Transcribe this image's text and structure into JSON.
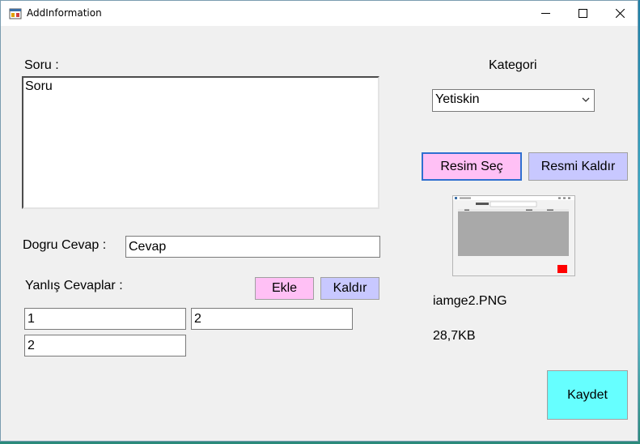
{
  "window": {
    "title": "AddInformation"
  },
  "question": {
    "label": "Soru :",
    "value": "Soru"
  },
  "category": {
    "label": "Kategori",
    "selected": "Yetiskin"
  },
  "image_buttons": {
    "select": "Resim Seç",
    "remove": "Resmi Kaldır"
  },
  "image_info": {
    "filename": "iamge2.PNG",
    "size": "28,7KB"
  },
  "correct_answer": {
    "label": "Dogru Cevap :",
    "value": "Cevap"
  },
  "wrong_answers": {
    "label": "Yanlış Cevaplar :",
    "add": "Ekle",
    "remove": "Kaldır",
    "values": [
      "1",
      "2",
      "2"
    ]
  },
  "save_button": "Kaydet",
  "colors": {
    "pink_button": "#ffc0f5",
    "lavender_button": "#c8c8ff",
    "save_cyan": "#66ffff",
    "preview_accent": "#ff0000"
  }
}
